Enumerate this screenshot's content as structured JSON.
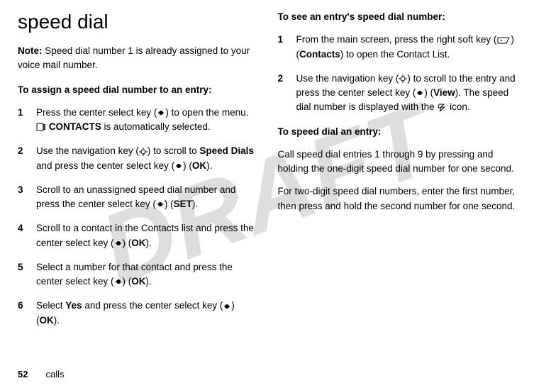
{
  "watermark": "DRAFT",
  "left": {
    "heading": "speed dial",
    "note_label": "Note:",
    "note_text": " Speed dial number 1 is already assigned to your voice mail number.",
    "subheading": "To assign a speed dial number to an entry",
    "steps": [
      {
        "num": "1",
        "pre": "Press the center select key (",
        "mid": ") to open the menu. ",
        "bold1": "CONTACTS",
        "post1": " is automatically selected."
      },
      {
        "num": "2",
        "pre": "Use the navigation key (",
        "mid": ") to scroll to ",
        "bold1": "Speed Dials",
        "mid2": " and press the center select key (",
        "mid3": ") (",
        "bold2": "OK",
        "post": ")."
      },
      {
        "num": "3",
        "pre": "Scroll to an unassigned speed dial number and press the center select key (",
        "mid": ") (",
        "bold1": "SET",
        "post": ")."
      },
      {
        "num": "4",
        "pre": "Scroll to a contact in the Contacts list and press the center select key (",
        "mid": ") (",
        "bold1": "OK",
        "post": ")."
      },
      {
        "num": "5",
        "pre": "Select a number for that contact and press the center select key (",
        "mid": ") (",
        "bold1": "OK",
        "post": ")."
      },
      {
        "num": "6",
        "pre": "Select ",
        "bold1": "Yes",
        "mid": " and press the center select key (",
        "mid2": ") (",
        "bold2": "OK",
        "post": ")."
      }
    ]
  },
  "right": {
    "subheading1": "To see an entry's speed dial number",
    "steps": [
      {
        "num": "1",
        "pre": "From the main screen, press the right soft key (",
        "mid": ") (",
        "bold1": "Contacts",
        "post": ") to open the Contact List."
      },
      {
        "num": "2",
        "pre": "Use the navigation key (",
        "mid": ") to scroll to the entry and press the center select key (",
        "mid2": ") (",
        "bold1": "View",
        "post": "). The speed dial number is displayed with the ",
        "post2": " icon."
      }
    ],
    "subheading2": "To speed dial an entry",
    "para1": "Call speed dial entries 1 through 9 by pressing and holding the one-digit speed dial number for one second.",
    "para2": "For two-digit speed dial numbers, enter the first number, then press and hold the second number for one second."
  },
  "footer": {
    "page": "52",
    "label": "calls"
  }
}
